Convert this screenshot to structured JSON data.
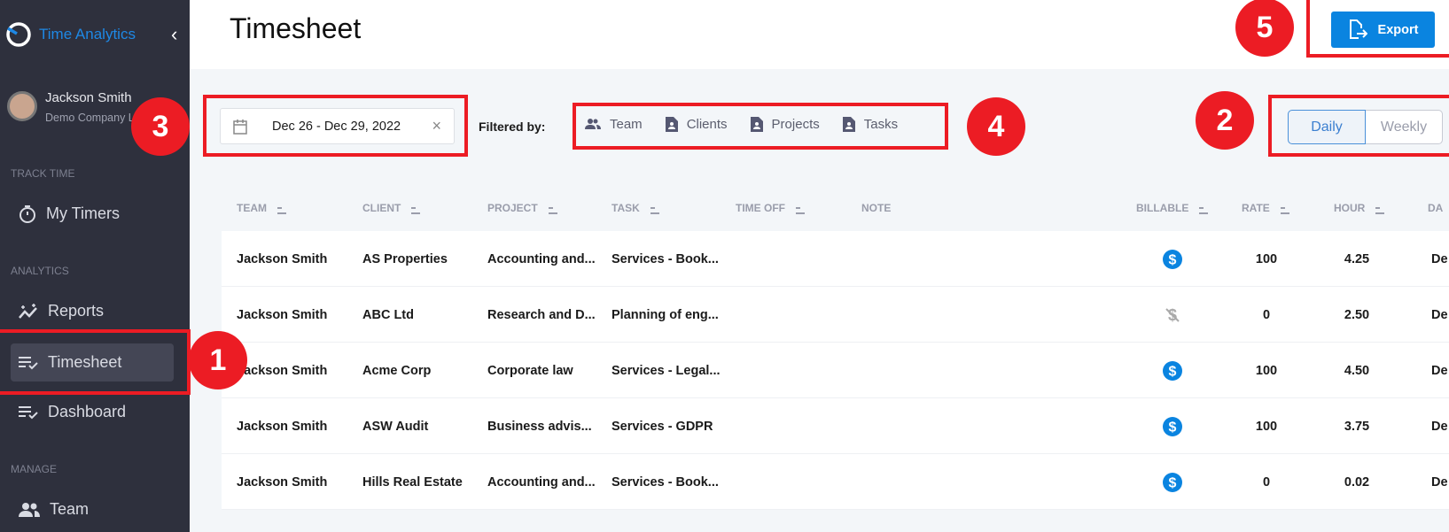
{
  "sidebar": {
    "app_name": "Time Analytics",
    "user": {
      "name": "Jackson Smith",
      "company": "Demo Company L"
    },
    "sections": {
      "track": "TRACK TIME",
      "analytics": "ANALYTICS",
      "manage": "MANAGE"
    },
    "items": [
      {
        "label": "My Timers"
      },
      {
        "label": "Reports"
      },
      {
        "label": "Timesheet",
        "active": true
      },
      {
        "label": "Dashboard"
      },
      {
        "label": "Team"
      }
    ]
  },
  "header": {
    "title": "Timesheet",
    "export_label": "Export"
  },
  "filters": {
    "date_range": "Dec 26 - Dec 29, 2022",
    "filtered_by_label": "Filtered by:",
    "items": [
      "Team",
      "Clients",
      "Projects",
      "Tasks"
    ]
  },
  "view_toggle": {
    "options": [
      "Daily",
      "Weekly"
    ],
    "selected": "Daily"
  },
  "annotations": [
    "1",
    "2",
    "3",
    "4",
    "5"
  ],
  "table": {
    "columns": [
      "TEAM",
      "CLIENT",
      "PROJECT",
      "TASK",
      "TIME OFF",
      "NOTE",
      "BILLABLE",
      "RATE",
      "HOUR",
      "DA"
    ],
    "rows": [
      {
        "team": "Jackson Smith",
        "client": "AS Properties",
        "project": "Accounting and...",
        "task": "Services - Book...",
        "billable": true,
        "rate": "100",
        "hour": "4.25",
        "date": "De"
      },
      {
        "team": "Jackson Smith",
        "client": "ABC Ltd",
        "project": "Research and D...",
        "task": "Planning of eng...",
        "billable": false,
        "rate": "0",
        "hour": "2.50",
        "date": "De"
      },
      {
        "team": "Jackson Smith",
        "client": "Acme Corp",
        "project": "Corporate law",
        "task": "Services - Legal...",
        "billable": true,
        "rate": "100",
        "hour": "4.50",
        "date": "De"
      },
      {
        "team": "Jackson Smith",
        "client": "ASW Audit",
        "project": "Business advis...",
        "task": "Services - GDPR",
        "billable": true,
        "rate": "100",
        "hour": "3.75",
        "date": "De"
      },
      {
        "team": "Jackson Smith",
        "client": "Hills Real Estate",
        "project": "Accounting and...",
        "task": "Services - Book...",
        "billable": true,
        "rate": "0",
        "hour": "0.02",
        "date": "De"
      }
    ]
  },
  "colors": {
    "accent": "#0a84e0",
    "sidebar": "#2e303d",
    "annotation": "#ec1c24"
  }
}
